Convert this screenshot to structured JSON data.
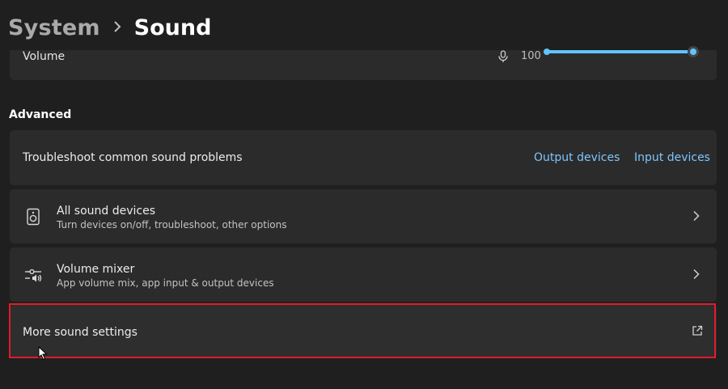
{
  "header": {
    "parent": "System",
    "separator": ">",
    "current": "Sound"
  },
  "volume": {
    "label": "Volume",
    "value": "100",
    "level_percent": 100,
    "icon": "microphone-icon"
  },
  "advanced": {
    "section_title": "Advanced",
    "troubleshoot": {
      "title": "Troubleshoot common sound problems",
      "output_link": "Output devices",
      "input_link": "Input devices"
    },
    "all_sound_devices": {
      "icon": "speaker-icon",
      "title": "All sound devices",
      "subtitle": "Turn devices on/off, troubleshoot, other options"
    },
    "volume_mixer": {
      "icon": "mixer-icon",
      "title": "Volume mixer",
      "subtitle": "App volume mix, app input & output devices"
    },
    "more_sound_settings": {
      "title": "More sound settings",
      "icon": "external-link-icon"
    }
  },
  "colors": {
    "background": "#1f1f1f",
    "card": "#2b2b2b",
    "accent": "#60c5ff",
    "link": "#7cc6ff",
    "highlight": "#e11b2b"
  }
}
